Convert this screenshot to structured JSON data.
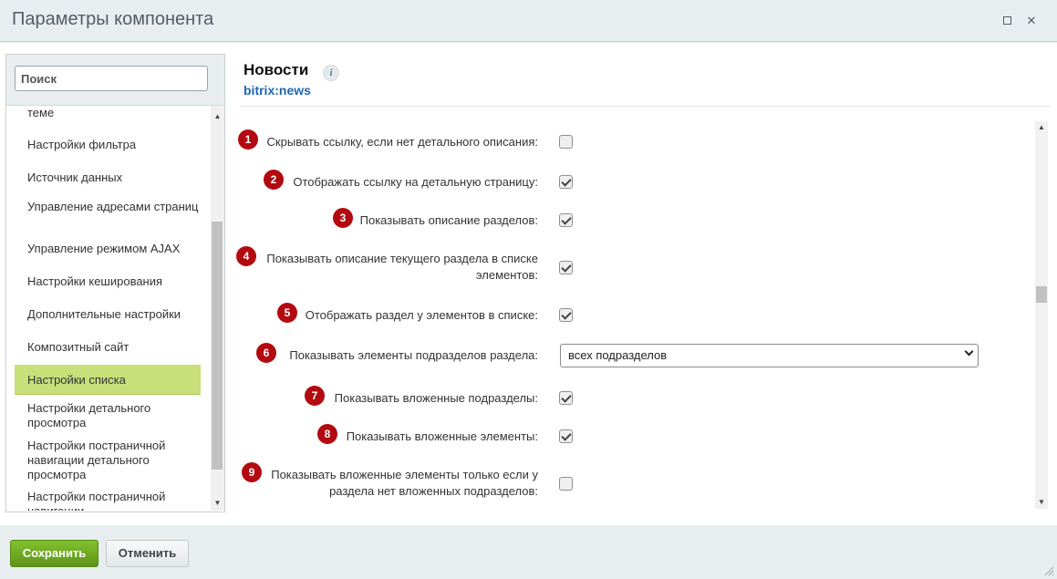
{
  "window": {
    "title": "Параметры компонента",
    "maximize_icon": "maximize-icon",
    "close_icon": "close-icon",
    "close_glyph": "✕"
  },
  "search": {
    "placeholder": "Поиск"
  },
  "sidebar": {
    "items": [
      {
        "label": "теме"
      },
      {
        "label": "Настройки фильтра"
      },
      {
        "label": "Источник данных"
      },
      {
        "label": "Управление адресами страниц"
      },
      {
        "label": "Управление режимом AJAX"
      },
      {
        "label": "Настройки кеширования"
      },
      {
        "label": "Дополнительные настройки"
      },
      {
        "label": "Композитный сайт"
      },
      {
        "label": "Настройки списка",
        "active": true
      },
      {
        "label": "Настройки детального просмотра"
      },
      {
        "label": "Настройки постраничной навигации детального просмотра"
      },
      {
        "label": "Настройки постраничной навигации"
      }
    ]
  },
  "component": {
    "name": "Новости",
    "code": "bitrix:news",
    "info_glyph": "i"
  },
  "properties": [
    {
      "number": "1",
      "label": "Скрывать ссылку, если нет детального описания:",
      "type": "checkbox",
      "checked": false
    },
    {
      "number": "2",
      "label": "Отображать ссылку на детальную страницу:",
      "type": "checkbox",
      "checked": true
    },
    {
      "number": "3",
      "label": "Показывать описание разделов:",
      "type": "checkbox",
      "checked": true
    },
    {
      "number": "4",
      "label": "Показывать описание текущего раздела в списке элементов:",
      "type": "checkbox",
      "checked": true
    },
    {
      "number": "5",
      "label": "Отображать раздел у элементов в списке:",
      "type": "checkbox",
      "checked": true
    },
    {
      "number": "6",
      "label": "Показывать элементы подразделов раздела:",
      "type": "select",
      "value": "всех подразделов"
    },
    {
      "number": "7",
      "label": "Показывать вложенные подразделы:",
      "type": "checkbox",
      "checked": true
    },
    {
      "number": "8",
      "label": "Показывать вложенные элементы:",
      "type": "checkbox",
      "checked": true
    },
    {
      "number": "9",
      "label": "Показывать вложенные элементы только если у раздела нет вложенных подразделов:",
      "type": "checkbox",
      "checked": false
    }
  ],
  "footer": {
    "save_label": "Сохранить",
    "cancel_label": "Отменить"
  },
  "colors": {
    "badge": "#b20a10",
    "active_item": "#c8df7a",
    "save_button": "#6ba120",
    "component_code": "#2067b0"
  }
}
